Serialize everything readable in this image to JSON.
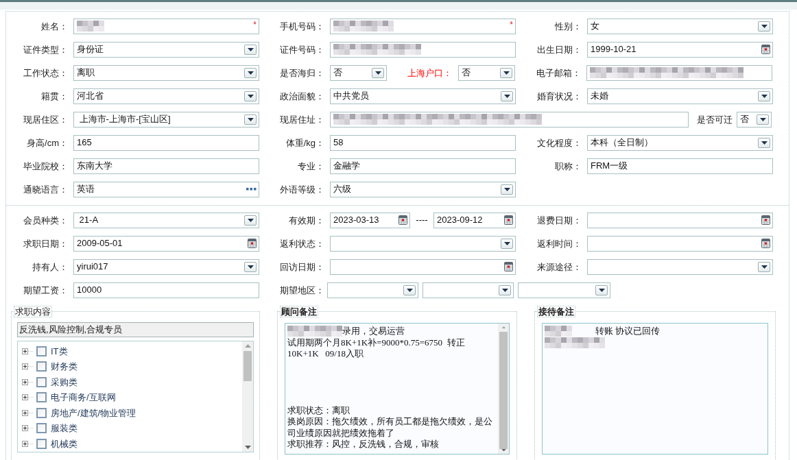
{
  "personal_rows": [
    [
      {
        "label": "姓名：",
        "kind": "text",
        "redacted": true,
        "marker": "*"
      },
      {
        "label": "手机号码：",
        "kind": "text",
        "redacted": true,
        "marker": "*"
      },
      {
        "label": "性别：",
        "kind": "select",
        "value": "女"
      }
    ],
    [
      {
        "label": "证件类型：",
        "kind": "select",
        "value": "身份证"
      },
      {
        "label": "证件号码：",
        "kind": "text",
        "redacted": true
      },
      {
        "label": "出生日期：",
        "kind": "date",
        "value": "1999-10-21"
      }
    ],
    [
      {
        "label": "工作状态：",
        "kind": "select",
        "value": "离职"
      },
      {
        "label": "是否海归：",
        "kind": "select",
        "value": "否"
      },
      {
        "label": "上海户口：",
        "kind": "select",
        "value": "否",
        "highlighted": true
      },
      {
        "label": "电子邮箱：",
        "kind": "text",
        "redacted": true
      }
    ],
    [
      {
        "label": "籍贯：",
        "kind": "select",
        "value": "河北省"
      },
      {
        "label": "政治面貌：",
        "kind": "select",
        "value": "中共党员"
      },
      {
        "label": "婚育状况：",
        "kind": "select",
        "value": "未婚"
      }
    ],
    [
      {
        "label": "现居住区：",
        "kind": "select",
        "value": " 上海市-上海市-[宝山区]"
      },
      {
        "label": "现居住址：",
        "kind": "text",
        "redacted": true
      },
      {
        "label": "是否可迁",
        "kind": "select",
        "value": "否"
      }
    ],
    [
      {
        "label": "身高/cm：",
        "kind": "text",
        "value": "165"
      },
      {
        "label": "体重/kg：",
        "kind": "text",
        "value": "58"
      },
      {
        "label": "文化程度：",
        "kind": "select",
        "value": "本科（全日制）"
      }
    ],
    [
      {
        "label": "毕业院校：",
        "kind": "text",
        "value": "东南大学"
      },
      {
        "label": "专业：",
        "kind": "text",
        "value": "金融学"
      },
      {
        "label": "职称：",
        "kind": "text",
        "value": "FRM一级"
      }
    ],
    [
      {
        "label": "通晓语言：",
        "kind": "lookup",
        "value": "英语"
      },
      {
        "label": "外语等级：",
        "kind": "select",
        "value": "六级"
      }
    ]
  ],
  "member_rows": [
    [
      {
        "label": "会员种类：",
        "kind": "select",
        "value": " 21-A"
      },
      {
        "label": "有效期：",
        "kind": "date_range",
        "values": [
          "2023-03-13",
          "2023-09-12"
        ],
        "separator": "----"
      },
      {
        "label": "退费日期：",
        "kind": "date"
      }
    ],
    [
      {
        "label": "求职日期：",
        "kind": "date",
        "value": "2009-05-01"
      },
      {
        "label": "返利状态：",
        "kind": "select"
      },
      {
        "label": "返利时间：",
        "kind": "date"
      }
    ],
    [
      {
        "label": "持有人：",
        "kind": "select",
        "value": "yirui017"
      },
      {
        "label": "回访日期：",
        "kind": "date"
      },
      {
        "label": "来源途径：",
        "kind": "select"
      }
    ],
    [
      {
        "label": "期望工资：",
        "kind": "text",
        "value": "10000"
      },
      {
        "label": "期望地区：",
        "kind": "region"
      }
    ]
  ],
  "job_content": {
    "legend": "求职内容",
    "bold": false,
    "summary": "反洗钱,风险控制,合规专员",
    "items": [
      {
        "label": "IT类",
        "checked": false,
        "expanded": false
      },
      {
        "label": "财务类",
        "checked": false,
        "expanded": false
      },
      {
        "label": "采购类",
        "checked": false,
        "expanded": false
      },
      {
        "label": "电子商务/互联网",
        "checked": false,
        "expanded": false
      },
      {
        "label": "房地产/建筑/物业管理",
        "checked": false,
        "expanded": false
      },
      {
        "label": "服装类",
        "checked": false,
        "expanded": false
      },
      {
        "label": "机械类",
        "checked": false,
        "expanded": false
      }
    ]
  },
  "advisor_notes": {
    "legend": "顾问备注",
    "bold": true,
    "lines": [
      {
        "kind": "text",
        "redacted": true,
        "text": "录用，交易运营"
      },
      {
        "kind": "text",
        "text": "试用期两个月8K+1K补=9000*0.75=6750  转正"
      },
      {
        "kind": "text",
        "text": "10K+1K   09/18入职"
      },
      {
        "kind": "blank"
      },
      {
        "kind": "blank"
      },
      {
        "kind": "blank"
      },
      {
        "kind": "blank"
      },
      {
        "kind": "text",
        "text": "求职状态：离职"
      },
      {
        "kind": "text",
        "text": "换岗原因：拖欠绩效，所有员工都是拖欠绩效，是公司业绩原因就把绩效拖着了"
      },
      {
        "kind": "text",
        "text": "求职推荐：风控，反洗钱，合规，审核"
      }
    ]
  },
  "reception_notes": {
    "legend": "接待备注",
    "bold": true,
    "lines": [
      {
        "kind": "text",
        "redacted": true,
        "text": "转账 协议已回传"
      },
      {
        "kind": "text",
        "redacted": true
      }
    ]
  }
}
